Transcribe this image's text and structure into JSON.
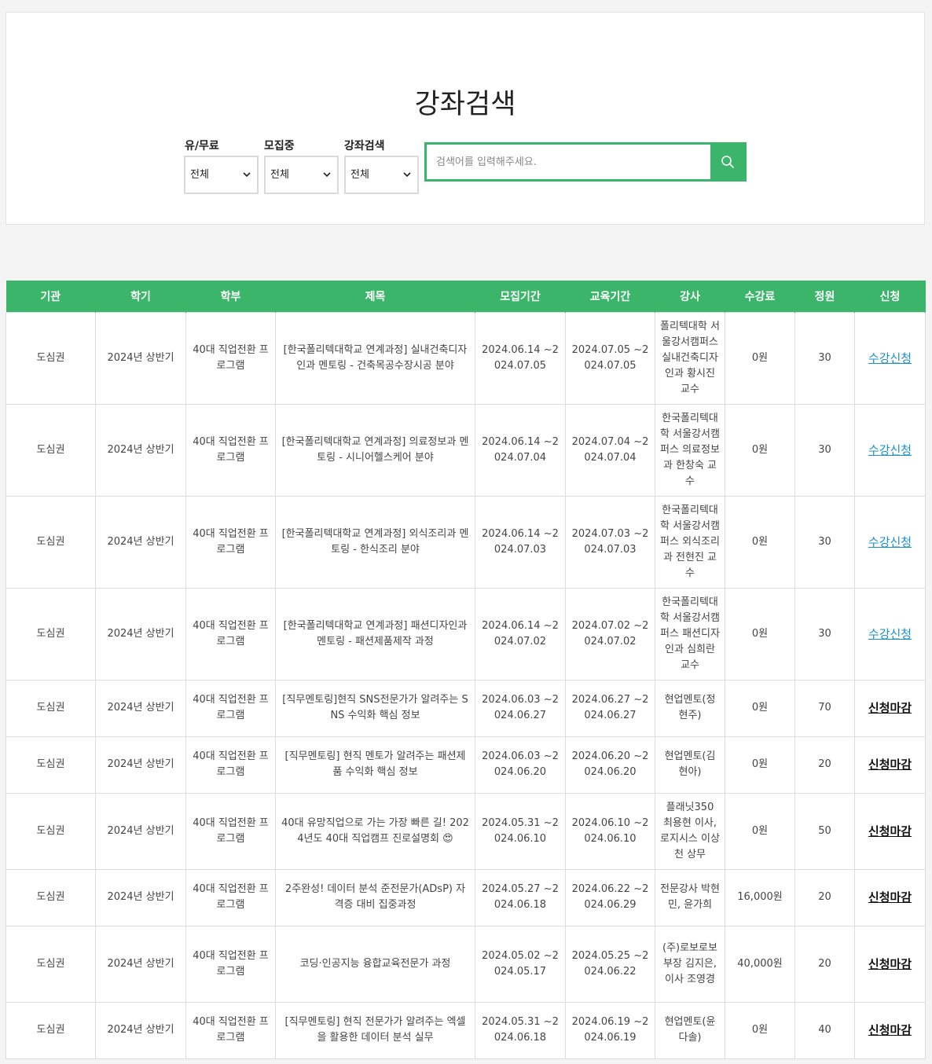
{
  "search": {
    "title": "강좌검색",
    "filters": [
      {
        "label": "유/무료",
        "value": "전체"
      },
      {
        "label": "모집중",
        "value": "전체"
      },
      {
        "label": "강좌검색",
        "value": "전체"
      }
    ],
    "placeholder": "검색어를 입력해주세요.",
    "accent": "#3bb56a"
  },
  "table": {
    "headers": [
      "기관",
      "학기",
      "학부",
      "제목",
      "모집기간",
      "교육기간",
      "강사",
      "수강료",
      "정원",
      "신청"
    ],
    "rows": [
      {
        "org": "도심권",
        "term": "2024년 상반기",
        "dept": "40대 직업전환 프로그램",
        "title": "[한국폴리텍대학교 연계과정] 실내건축디자인과 멘토링 - 건축목공수장시공 분야",
        "recruit": "2024.06.14 ~2024.07.05",
        "edu": "2024.07.05 ~2024.07.05",
        "teacher": "폴리텍대학 서울강서캠퍼스 실내건축디자인과 황시진 교수",
        "fee": "0원",
        "cap": "30",
        "apply": "수강신청",
        "open": true
      },
      {
        "org": "도심권",
        "term": "2024년 상반기",
        "dept": "40대 직업전환 프로그램",
        "title": "[한국폴리텍대학교 연계과정] 의료정보과 멘토링 - 시니어헬스케어 분야",
        "recruit": "2024.06.14 ~2024.07.04",
        "edu": "2024.07.04 ~2024.07.04",
        "teacher": "한국폴리텍대학 서울강서캠퍼스 의료정보과 한창숙 교수",
        "fee": "0원",
        "cap": "30",
        "apply": "수강신청",
        "open": true
      },
      {
        "org": "도심권",
        "term": "2024년 상반기",
        "dept": "40대 직업전환 프로그램",
        "title": "[한국폴리텍대학교 연계과정] 외식조리과 멘토링 - 한식조리 분야",
        "recruit": "2024.06.14 ~2024.07.03",
        "edu": "2024.07.03 ~2024.07.03",
        "teacher": "한국폴리텍대학 서울강서캠퍼스 외식조리과 전현진 교수",
        "fee": "0원",
        "cap": "30",
        "apply": "수강신청",
        "open": true
      },
      {
        "org": "도심권",
        "term": "2024년 상반기",
        "dept": "40대 직업전환 프로그램",
        "title": "[한국폴리텍대학교 연계과정] 패션디자인과 멘토링 - 패션제품제작 과정",
        "recruit": "2024.06.14 ~2024.07.02",
        "edu": "2024.07.02 ~2024.07.02",
        "teacher": "한국폴리텍대학 서울강서캠퍼스 패션디자인과 심희란 교수",
        "fee": "0원",
        "cap": "30",
        "apply": "수강신청",
        "open": true
      },
      {
        "org": "도심권",
        "term": "2024년 상반기",
        "dept": "40대 직업전환 프로그램",
        "title": "[직무멘토링]현직 SNS전문가가 알려주는 SNS 수익화 핵심 정보",
        "recruit": "2024.06.03 ~2024.06.27",
        "edu": "2024.06.27 ~2024.06.27",
        "teacher": "현업멘토(정현주)",
        "fee": "0원",
        "cap": "70",
        "apply": "신청마감",
        "open": false
      },
      {
        "org": "도심권",
        "term": "2024년 상반기",
        "dept": "40대 직업전환 프로그램",
        "title": "[직무멘토링] 현직 멘토가 알려주는 패션제품 수익화 핵심 정보",
        "recruit": "2024.06.03 ~2024.06.20",
        "edu": "2024.06.20 ~2024.06.20",
        "teacher": "현업멘토(김현아)",
        "fee": "0원",
        "cap": "20",
        "apply": "신청마감",
        "open": false
      },
      {
        "org": "도심권",
        "term": "2024년 상반기",
        "dept": "40대 직업전환 프로그램",
        "title": "40대 유망직업으로 가는 가장 빠른 길! 2024년도 40대 직업캠프 진로설명회 😍",
        "recruit": "2024.05.31 ~2024.06.10",
        "edu": "2024.06.10 ~2024.06.10",
        "teacher": "플래닛350 최용현 이사, 로지시스 이상천 상무",
        "fee": "0원",
        "cap": "50",
        "apply": "신청마감",
        "open": false
      },
      {
        "org": "도심권",
        "term": "2024년 상반기",
        "dept": "40대 직업전환 프로그램",
        "title": "2주완성! 데이터 분석 준전문가(ADsP) 자격증 대비 집중과정",
        "recruit": "2024.05.27 ~2024.06.18",
        "edu": "2024.06.22 ~2024.06.29",
        "teacher": "전문강사 박현민, 윤가희",
        "fee": "16,000원",
        "cap": "20",
        "apply": "신청마감",
        "open": false
      },
      {
        "org": "도심권",
        "term": "2024년 상반기",
        "dept": "40대 직업전환 프로그램",
        "title": "코딩·인공지능 융합교육전문가 과정",
        "recruit": "2024.05.02 ~2024.05.17",
        "edu": "2024.05.25 ~2024.06.22",
        "teacher": "(주)로보로보 부장 김지은, 이사 조영경",
        "fee": "40,000원",
        "cap": "20",
        "apply": "신청마감",
        "open": false
      },
      {
        "org": "도심권",
        "term": "2024년 상반기",
        "dept": "40대 직업전환 프로그램",
        "title": "[직무멘토링] 현직 전문가가 알려주는 엑셀을 활용한 데이터 분석 실무",
        "recruit": "2024.05.31 ~2024.06.18",
        "edu": "2024.06.19 ~2024.06.19",
        "teacher": "현업멘토(윤다솔)",
        "fee": "0원",
        "cap": "40",
        "apply": "신청마감",
        "open": false
      }
    ]
  }
}
